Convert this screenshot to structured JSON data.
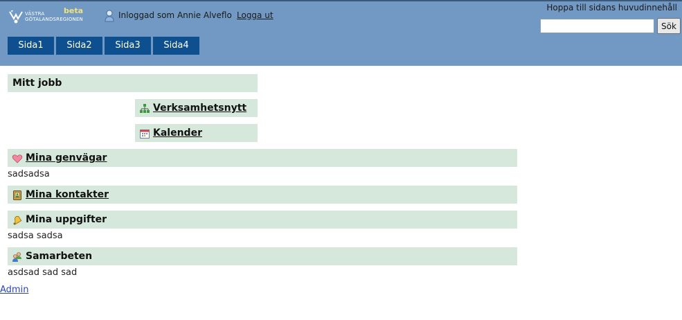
{
  "header": {
    "logo_text_line1": "VÄSTRA",
    "logo_text_line2": "GÖTALANDSREGIONEN",
    "logo_beta": "beta",
    "user_text": "Inloggad som Annie Alveflo",
    "logout_label": "Logga ut",
    "skip_link": "Hoppa till sidans huvudinnehåll",
    "search_value": "",
    "search_button": "Sök"
  },
  "tabs": [
    "Sida1",
    "Sida2",
    "Sida3",
    "Sida4"
  ],
  "main": {
    "mitt_jobb": "Mitt jobb",
    "verksamhetsnytt": "Verksamhetsnytt",
    "kalender": "Kalender",
    "mina_genvagar": "Mina genvägar",
    "mina_genvagar_text": "sadsadsa",
    "mina_kontakter": "Mina kontakter",
    "mina_uppgifter": "Mina uppgifter",
    "mina_uppgifter_text": "sadsa sadsa",
    "samarbeten": "Samarbeten",
    "samarbeten_text": "asdsad sad sad"
  },
  "footer": {
    "admin_label": "Admin"
  },
  "colors": {
    "header_bg": "#7199c3",
    "tab_bg": "#0d4f8f",
    "section_bg": "#d6e8db",
    "link": "#2a44c0"
  },
  "icons": {
    "verksamhetsnytt": "org-chart-icon",
    "kalender": "calendar-icon",
    "mina_genvagar": "heart-icon",
    "mina_kontakter": "address-book-icon",
    "mina_uppgifter": "bell-icon",
    "samarbeten": "users-icon"
  }
}
